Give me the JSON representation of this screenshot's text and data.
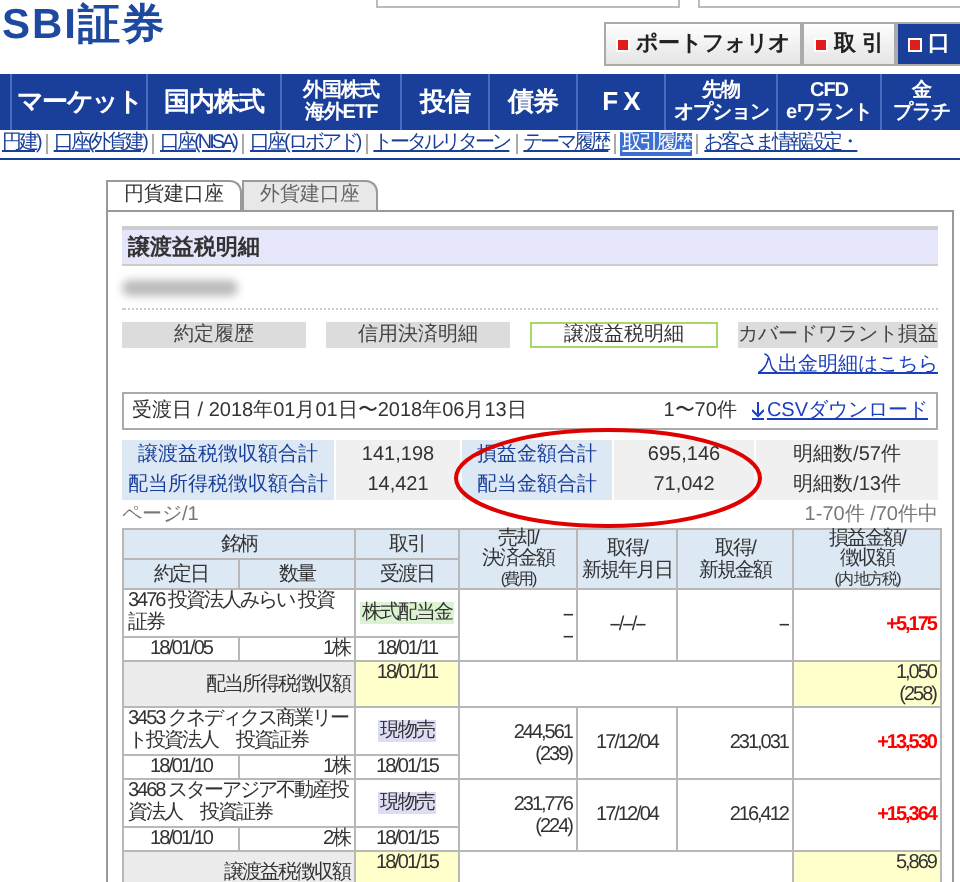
{
  "header": {
    "logo": "SBI証券",
    "buttons": [
      {
        "label": "ポートフォリオ",
        "selected": false
      },
      {
        "label": "取 引",
        "selected": false
      },
      {
        "label": "口",
        "selected": true
      }
    ]
  },
  "nav": [
    {
      "lines": [
        "マーケット"
      ]
    },
    {
      "lines": [
        "国内株式"
      ]
    },
    {
      "lines": [
        "外国株式",
        "海外ETF"
      ]
    },
    {
      "lines": [
        "投信"
      ]
    },
    {
      "lines": [
        "債券"
      ]
    },
    {
      "lines": [
        "F X"
      ]
    },
    {
      "lines": [
        "先物",
        "オプション"
      ]
    },
    {
      "lines": [
        "CFD",
        "eワラント"
      ]
    },
    {
      "lines": [
        "金",
        "プラチ"
      ]
    }
  ],
  "sub_nav": [
    {
      "label": "円建)",
      "selected": false
    },
    {
      "label": "口座(外貨建)",
      "selected": false
    },
    {
      "label": "口座(NISA)",
      "selected": false
    },
    {
      "label": "口座(ロボアド)",
      "selected": false
    },
    {
      "label": "トータルリターン",
      "selected": false
    },
    {
      "label": "テーマ履歴",
      "selected": false
    },
    {
      "label": "取引履歴",
      "selected": true
    },
    {
      "label": "お客さま情報設定・",
      "selected": false
    }
  ],
  "account_tabs": [
    {
      "label": "円貨建口座",
      "selected": true
    },
    {
      "label": "外貨建口座",
      "selected": false
    }
  ],
  "section_title": "譲渡益税明細",
  "view_buttons": [
    {
      "label": "約定履歴",
      "selected": false
    },
    {
      "label": "信用決済明細",
      "selected": false
    },
    {
      "label": "譲渡益税明細",
      "selected": true
    },
    {
      "label": "カバードワラント損益",
      "selected": false
    }
  ],
  "deposit_link": "入出金明細はこちら",
  "filter": {
    "range": "受渡日 / 2018年01月01日〜2018年06月13日",
    "count": "1〜70件",
    "csv_link": "CSVダウンロード"
  },
  "summary": [
    {
      "label": "譲渡益税徴収額合計",
      "value": "141,198",
      "label_2": "損益金額合計",
      "value_2": "695,146",
      "count": "明細数/57件"
    },
    {
      "label": "配当所得税徴収額合計",
      "value": "14,421",
      "label_2": "配当金額合計",
      "value_2": "71,042",
      "count": "明細数/13件"
    }
  ],
  "pager": {
    "page": "ページ/1",
    "range": "1-70件 /70件中"
  },
  "table": {
    "columns": {
      "name": "銘柄",
      "trade": "取引",
      "sale": "売却/\n決済金額",
      "sale_note": "(費用)",
      "acq_date": "取得/\n新規年月日",
      "acq_amount": "取得/\n新規金額",
      "profit": "損益金額/\n徴収額",
      "profit_note": "(内 地方税)",
      "trade_date": "約定日",
      "quantity": "数量",
      "delivery": "受渡日"
    },
    "rows": [
      {
        "kind": "trade",
        "name": "3476 投資法人みらい 投資証券",
        "trade_type": "株式配当金",
        "color": "#dcf3d2",
        "sale_amount": "--",
        "fee": "--",
        "acquired_date": "--/--/--",
        "acquired_amount": "--",
        "profit": "+5,175",
        "trade_date": "18/01/05",
        "quantity": "1株",
        "delivery_date": "18/01/11"
      },
      {
        "kind": "tax",
        "label": "配当所得税徴収額",
        "delivery_date": "18/01/11",
        "amount": "1,050",
        "local_tax": "(258)"
      },
      {
        "kind": "trade",
        "name": "3453 クネディクス商業リート投資法人　投資証券",
        "trade_type": "現物売",
        "color": "#dcdcf5",
        "sale_amount": "244,561",
        "fee": "(239)",
        "acquired_date": "17/12/04",
        "acquired_amount": "231,031",
        "profit": "+13,530",
        "trade_date": "18/01/10",
        "quantity": "1株",
        "delivery_date": "18/01/15"
      },
      {
        "kind": "trade",
        "name": "3468 スターアジア不動産投資法人　投資証券",
        "trade_type": "現物売",
        "color": "#dcdcf5",
        "sale_amount": "231,776",
        "fee": "(224)",
        "acquired_date": "17/12/04",
        "acquired_amount": "216,412",
        "profit": "+15,364",
        "trade_date": "18/01/10",
        "quantity": "2株",
        "delivery_date": "18/01/15"
      },
      {
        "kind": "tax",
        "label": "譲渡益税徴収額",
        "delivery_date": "18/01/15",
        "amount": "5,869"
      }
    ]
  },
  "annotation": {
    "kind": "ellipse"
  }
}
